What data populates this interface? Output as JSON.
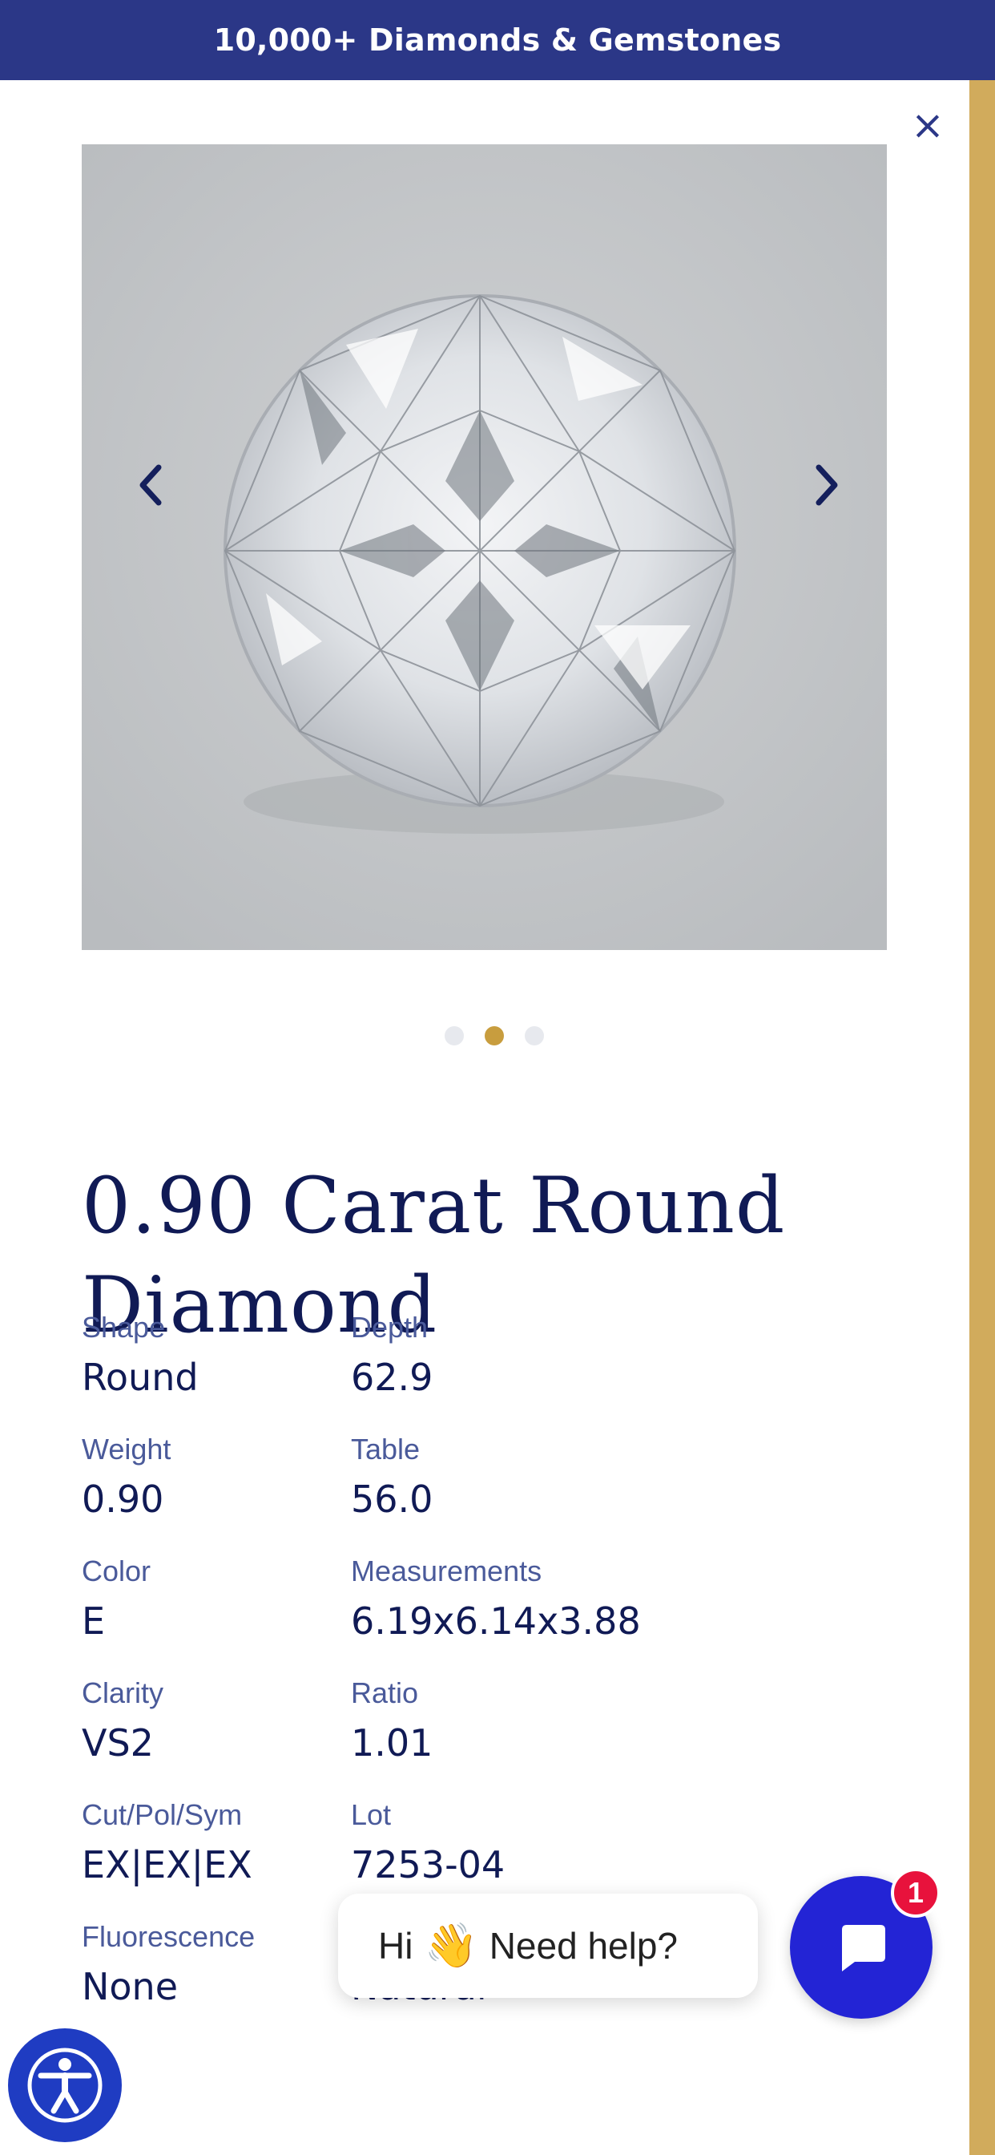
{
  "banner": {
    "text": "10,000+ Diamonds & Gemstones"
  },
  "close_icon": "close-icon",
  "gallery": {
    "image": "round-diamond-photo",
    "active_index": 2,
    "total": 3
  },
  "product": {
    "title": "0.90 Carat Round Diamond"
  },
  "specs": [
    {
      "label": "Shape",
      "value": "Round"
    },
    {
      "label": "Depth",
      "value": "62.9"
    },
    {
      "label": "Weight",
      "value": "0.90"
    },
    {
      "label": "Table",
      "value": "56.0"
    },
    {
      "label": "Color",
      "value": "E"
    },
    {
      "label": "Measurements",
      "value": "6.19x6.14x3.88"
    },
    {
      "label": "Clarity",
      "value": "VS2"
    },
    {
      "label": "Ratio",
      "value": "1.01"
    },
    {
      "label": "Cut/Pol/Sym",
      "value": "EX|EX|EX"
    },
    {
      "label": "Lot",
      "value": "7253-04"
    },
    {
      "label": "Fluorescence",
      "value": "None"
    },
    {
      "label": "",
      "value": "Natural"
    }
  ],
  "chat": {
    "greeting_hi": "Hi",
    "greeting_rest": "Need help?",
    "badge": "1"
  },
  "colors": {
    "navy": "#2b3787",
    "gold": "#d1ab5c",
    "chat_blue": "#2324d5",
    "badge_red": "#e8123c"
  }
}
